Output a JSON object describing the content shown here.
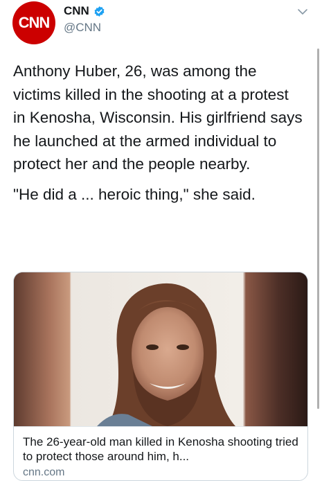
{
  "author": {
    "display_name": "CNN",
    "handle": "@CNN",
    "avatar_logo_text": "CNN",
    "brand_color": "#cc0000",
    "verified": true,
    "verified_color": "#1da1f2"
  },
  "tweet": {
    "paragraphs": [
      "Anthony Huber, 26, was among the victims killed in the shooting at a protest in Kenosha, Wisconsin. His girlfriend says he launched at the armed individual to protect her and the people nearby.",
      "\"He did a ... heroic thing,\" she said."
    ]
  },
  "link_card": {
    "title": "The 26-year-old man killed in Kenosha shooting tried to protect those around him, h...",
    "domain": "cnn.com",
    "image_subject": "portrait-photo"
  },
  "icons": {
    "menu": "chevron-down-icon",
    "verified": "verified-badge-icon"
  }
}
